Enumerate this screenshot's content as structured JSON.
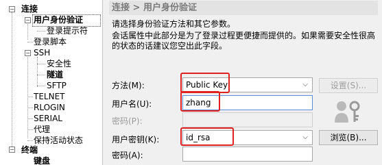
{
  "tree": {
    "connection": "连接",
    "user_auth": "用户身份验证",
    "login_prompt": "登录提示符",
    "login_script": "登录脚本",
    "ssh": "SSH",
    "security": "安全性",
    "tunnel": "隧道",
    "sftp": "SFTP",
    "telnet": "TELNET",
    "rlogin": "RLOGIN",
    "serial": "SERIAL",
    "proxy": "代理",
    "keepalive": "保持活动状态",
    "terminal": "终端",
    "keyboard": "键盘"
  },
  "panel": {
    "breadcrumb": "连接 > 用户身份验证",
    "desc1": "请选择身份验证方法和其它参数。",
    "desc2": "会话属性中此部分是为了登录过程更便捷而提供的。如果需要安全性很高",
    "desc3": "的状态的话建议您空出此字段。"
  },
  "form": {
    "method_label": "方法(M):",
    "method_value": "Public Key",
    "settings_button": "设置(S)...",
    "username_label": "用户名(U):",
    "username_value": "zhang",
    "password_label": "密码(P):",
    "userkey_label": "用户密钥(K):",
    "userkey_value": "id_rsa",
    "browse_button": "浏览(B)...",
    "passphrase_label": "密码(A):"
  },
  "colors": {
    "highlight": "#e02020",
    "header_bg": "#e3e3e3"
  }
}
